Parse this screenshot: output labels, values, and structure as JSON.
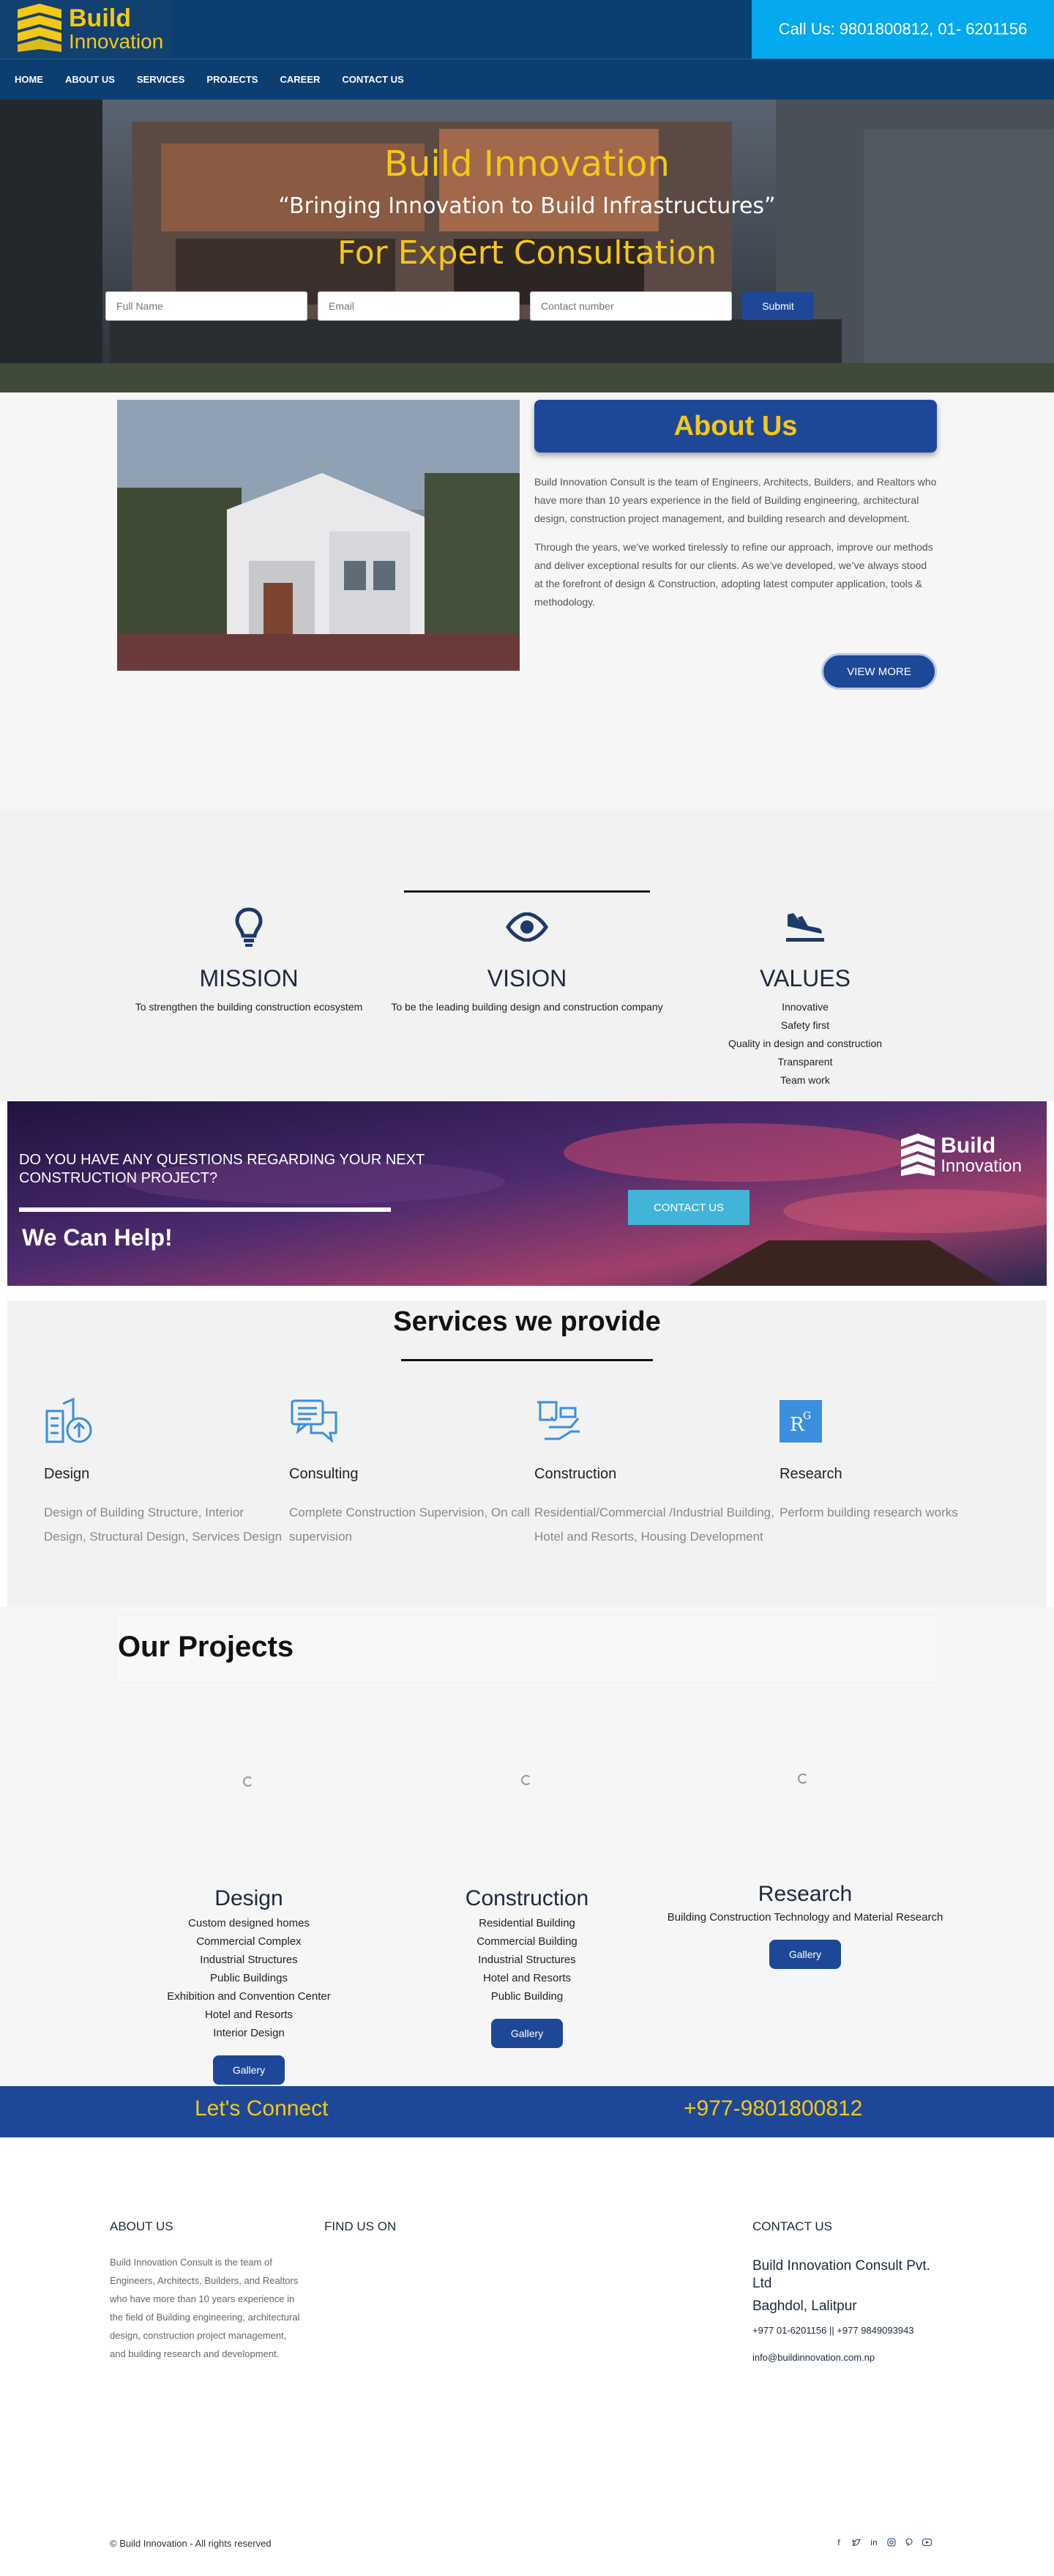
{
  "brand": {
    "name_line1": "Build",
    "name_line2": "Innovation"
  },
  "topbar": {
    "call_text": "Call Us: 9801800812, 01- 6201156"
  },
  "nav": {
    "items": [
      "HOME",
      "ABOUT US",
      "SERVICES",
      "PROJECTS",
      "CAREER",
      "CONTACT US"
    ]
  },
  "hero": {
    "title": "Build Innovation",
    "subtitle": "“Bringing Innovation to Build Infrastructures”",
    "consultation": "For Expert Consultation",
    "form": {
      "name_placeholder": "Full Name",
      "email_placeholder": "Email",
      "contact_placeholder": "Contact number",
      "submit_label": "Submit"
    }
  },
  "about": {
    "heading": "About Us",
    "paragraph1": "Build Innovation Consult is the team of Engineers, Architects, Builders, and Realtors who have more than 10 years experience in the field of Building engineering, architectural design, construction project management, and building research and development.",
    "paragraph2": "Through the years, we’ve worked tirelessly to refine our approach, improve our methods and deliver exceptional results for our clients. As we’ve developed, we’ve always stood at the forefront of design & Construction, adopting latest computer application, tools & methodology.",
    "view_more_label": "VIEW MORE"
  },
  "mvv": {
    "mission": {
      "title": "MISSION",
      "text": "To strengthen the building construction ecosystem"
    },
    "vision": {
      "title": "VISION",
      "text": "To be the leading building design and construction company"
    },
    "values": {
      "title": "VALUES",
      "items": [
        "Innovative",
        "Safety first",
        "Quality in design and construction",
        "Transparent",
        "Team work"
      ]
    }
  },
  "help": {
    "question": "DO YOU HAVE ANY QUESTIONS REGARDING YOUR NEXT CONSTRUCTION PROJECT?",
    "can_help": "We Can Help!",
    "contact_label": "CONTACT US"
  },
  "services": {
    "heading": "Services we provide",
    "items": [
      {
        "title": "Design",
        "text": "Design of Building Structure, Interior Design, Structural Design, Services Design"
      },
      {
        "title": "Consulting",
        "text": "Complete Construction Supervision, On call supervision"
      },
      {
        "title": "Construction",
        "text": "Residential/Commercial /Industrial Building, Hotel and Resorts, Housing Development"
      },
      {
        "title": "Research",
        "text": "Perform building research works"
      }
    ]
  },
  "projects": {
    "heading": "Our Projects",
    "design": {
      "title": "Design",
      "items": [
        "Custom designed homes",
        "Commercial Complex",
        "Industrial Structures",
        "Public Buildings",
        "Exhibition and Convention Center",
        "Hotel and Resorts",
        "Interior Design"
      ]
    },
    "construction": {
      "title": "Construction",
      "items": [
        "Residential Building",
        "Commercial Building",
        "Industrial Structures",
        "Hotel and Resorts",
        "Public Building"
      ]
    },
    "research": {
      "title": "Research",
      "text": "Building Construction Technology and Material Research"
    },
    "gallery_label": "Gallery"
  },
  "connect": {
    "label": "Let's Connect",
    "phone": "+977-9801800812"
  },
  "footer": {
    "about_heading": "ABOUT US",
    "about_text": "Build Innovation Consult is the team of Engineers, Architects, Builders, and Realtors who have more than 10 years experience in the field of Building engineering, architectural design, construction project management, and building research and development.",
    "find_heading": "FIND US ON",
    "contact_heading": "CONTACT US",
    "company": "Build Innovation Consult Pvt. Ltd",
    "address": "Baghdol, Lalitpur",
    "phones": "+977 01-6201156 || +977 9849093943",
    "email": "info@buildinnovation.com.np",
    "copyright": "© Build Innovation - All rights reserved",
    "social_icons": [
      "facebook-icon",
      "twitter-icon",
      "linkedin-icon",
      "instagram-icon",
      "pinterest-icon",
      "youtube-icon"
    ]
  },
  "colors": {
    "brand_yellow": "#f5c815",
    "navy": "#0d3e72",
    "primary_blue": "#1e4897",
    "cyan": "#05a9ee",
    "service_icon": "#3b8fdc"
  }
}
